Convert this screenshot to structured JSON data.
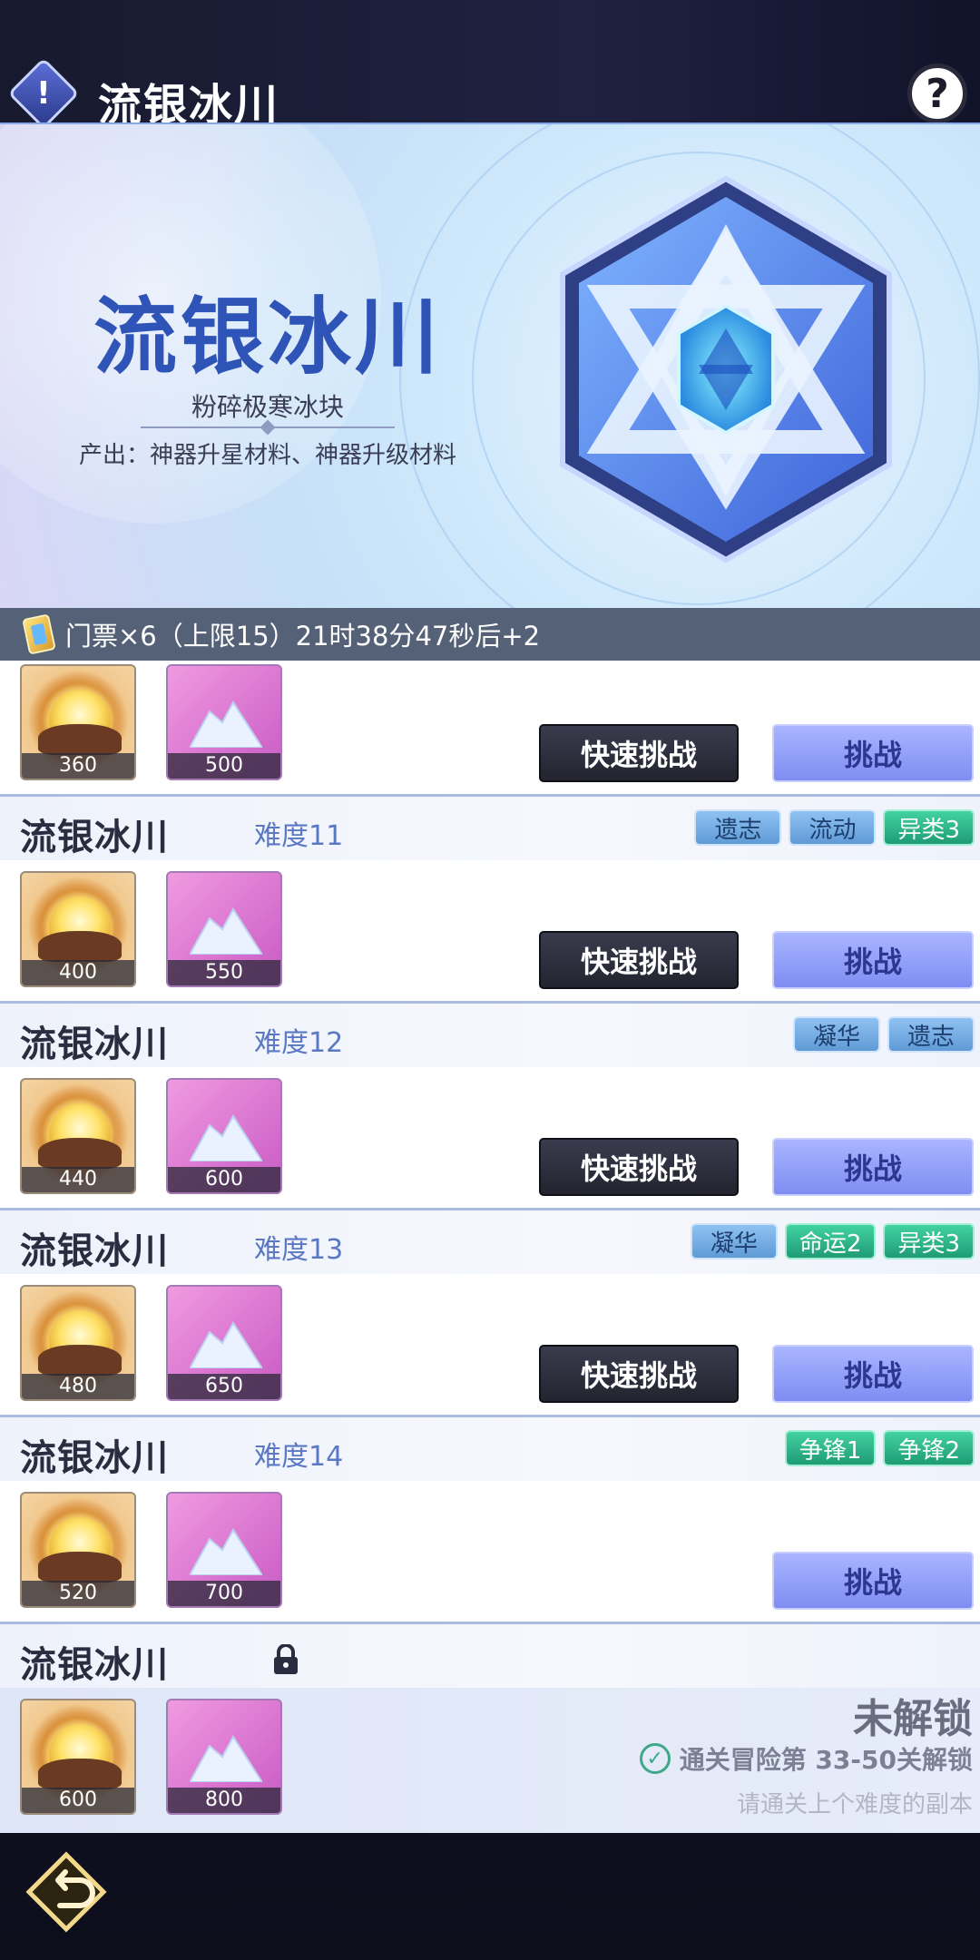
{
  "header": {
    "alert_icon": "!",
    "title": "流银冰川",
    "help_icon": "?"
  },
  "banner": {
    "title": "流银冰川",
    "subtitle": "粉碎极寒冰块",
    "output": "产出：神器升星材料、神器升级材料"
  },
  "ticket": {
    "text": "门票×6（上限15）21时38分47秒后+2"
  },
  "buttons": {
    "quick": "快速挑战",
    "challenge": "挑战"
  },
  "rows": [
    {
      "name": "",
      "difficulty": "",
      "tags": [],
      "gold": "360",
      "gem": "500",
      "quick": true
    },
    {
      "name": "流银冰川",
      "difficulty": "难度11",
      "tags": [
        {
          "text": "遗志",
          "color": "blue"
        },
        {
          "text": "流动",
          "color": "blue"
        },
        {
          "text": "异类3",
          "color": "green"
        }
      ],
      "gold": "400",
      "gem": "550",
      "quick": true
    },
    {
      "name": "流银冰川",
      "difficulty": "难度12",
      "tags": [
        {
          "text": "凝华",
          "color": "blue"
        },
        {
          "text": "遗志",
          "color": "blue"
        }
      ],
      "gold": "440",
      "gem": "600",
      "quick": true
    },
    {
      "name": "流银冰川",
      "difficulty": "难度13",
      "tags": [
        {
          "text": "凝华",
          "color": "blue"
        },
        {
          "text": "命运2",
          "color": "green"
        },
        {
          "text": "异类3",
          "color": "green"
        }
      ],
      "gold": "480",
      "gem": "650",
      "quick": true
    },
    {
      "name": "流银冰川",
      "difficulty": "难度14",
      "tags": [
        {
          "text": "争锋1",
          "color": "green"
        },
        {
          "text": "争锋2",
          "color": "green"
        }
      ],
      "gold": "520",
      "gem": "700",
      "quick": false
    }
  ],
  "locked": {
    "name": "流银冰川",
    "gold": "600",
    "gem": "800",
    "status": "未解锁",
    "condition": "通关冒险第 33-50关解锁",
    "hint": "请通关上个难度的副本"
  },
  "colors": {
    "accent": "#2f54b8",
    "tag_blue": "#5f9ad6",
    "tag_green": "#1f9c74",
    "challenge_btn": "#7f8df2"
  }
}
